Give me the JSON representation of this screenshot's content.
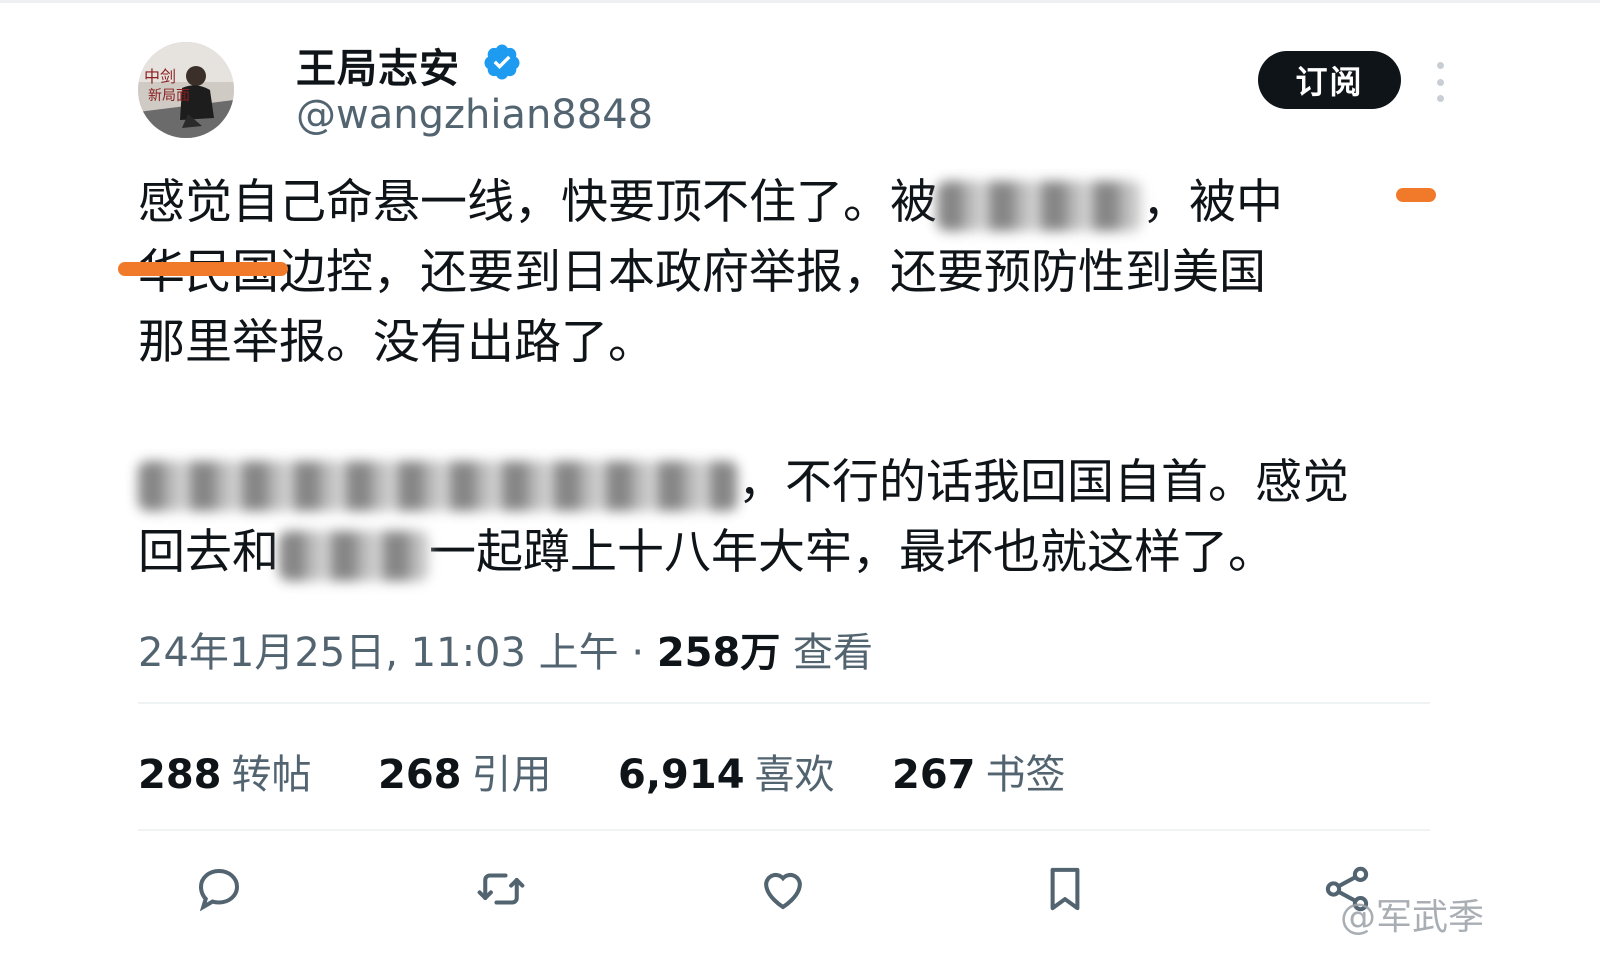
{
  "tweet": {
    "author": {
      "display_name": "王局志安",
      "handle": "@wangzhian8848",
      "verified": true
    },
    "subscribe_label": "订阅",
    "text_lines": [
      "感觉自己命悬一线，快要顶不住了。被",
      "，被中",
      "华民国边控，还要到日本政府举报，还要预防性到美国",
      "那里举报。没有出路了。",
      "，不行的话我回国自首。感觉",
      "回去和",
      "一起蹲上十八年大牢，最坏也就这样了。"
    ],
    "timestamp": "24年1月25日, 11:03 上午",
    "views_value": "258万",
    "views_label": "查看",
    "stats": {
      "reposts_value": "288",
      "reposts_label": "转帖",
      "quotes_value": "268",
      "quotes_label": "引用",
      "likes_value": "6,914",
      "likes_label": "喜欢",
      "bookmarks_value": "267",
      "bookmarks_label": "书签"
    },
    "icons": [
      "reply-icon",
      "repost-icon",
      "like-icon",
      "bookmark-icon",
      "share-icon",
      "more-options-icon",
      "verified-badge-icon"
    ],
    "colors": {
      "verified": "#1d9bf0",
      "redaction_strike": "#f07a2a"
    }
  },
  "watermark": "@军武季"
}
